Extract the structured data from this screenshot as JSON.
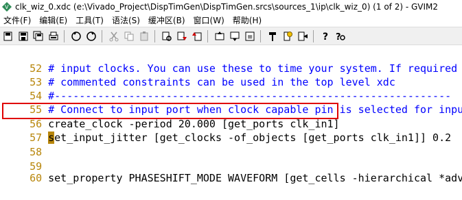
{
  "window": {
    "title": "clk_wiz_0.xdc (e:\\Vivado_Project\\DispTimGen\\DispTimGen.srcs\\sources_1\\ip\\clk_wiz_0) (1 of 2) - GVIM2"
  },
  "menu": {
    "items": [
      "文件(F)",
      "编辑(E)",
      "工具(T)",
      "语法(S)",
      "缓冲区(B)",
      "窗口(W)",
      "帮助(H)"
    ]
  },
  "toolbar": {
    "buttons": [
      "open-icon",
      "save-icon",
      "save-all-icon",
      "print-icon",
      "undo-icon",
      "redo-icon",
      "cut-icon",
      "copy-icon",
      "paste-icon",
      "find-replace-icon",
      "find-next-icon",
      "find-prev-icon",
      "load-session-icon",
      "save-session-icon",
      "run-script-icon",
      "make-icon",
      "run-ctags-icon",
      "jump-tag-icon",
      "help-icon",
      "find-help-icon"
    ]
  },
  "editor": {
    "lines": [
      {
        "num": "52",
        "text": "# input clocks. You can use these to time your system. If required",
        "kind": "comment"
      },
      {
        "num": "53",
        "text": "# commented constraints can be used in the top level xdc",
        "kind": "comment"
      },
      {
        "num": "54",
        "text": "#----------------------------------------------------------------",
        "kind": "comment"
      },
      {
        "num": "55",
        "text": "# Connect to input port when clock capable pin is selected for input",
        "kind": "comment"
      },
      {
        "num": "56",
        "text": "create_clock -period 20.000 [get_ports clk_in1]",
        "kind": "normal"
      },
      {
        "num": "57",
        "cursor_char": "s",
        "text": "et_input_jitter [get_clocks -of_objects [get_ports clk_in1]] 0.2",
        "kind": "normal"
      },
      {
        "num": "58",
        "text": "",
        "kind": "normal"
      },
      {
        "num": "59",
        "text": "",
        "kind": "normal"
      },
      {
        "num": "60",
        "text": "set_property PHASESHIFT_MODE WAVEFORM [get_cells -hierarchical *adv*]",
        "kind": "normal"
      }
    ]
  },
  "colors": {
    "line_number": "#b8860b",
    "comment": "#0000ff",
    "highlight_border": "#e00000"
  }
}
